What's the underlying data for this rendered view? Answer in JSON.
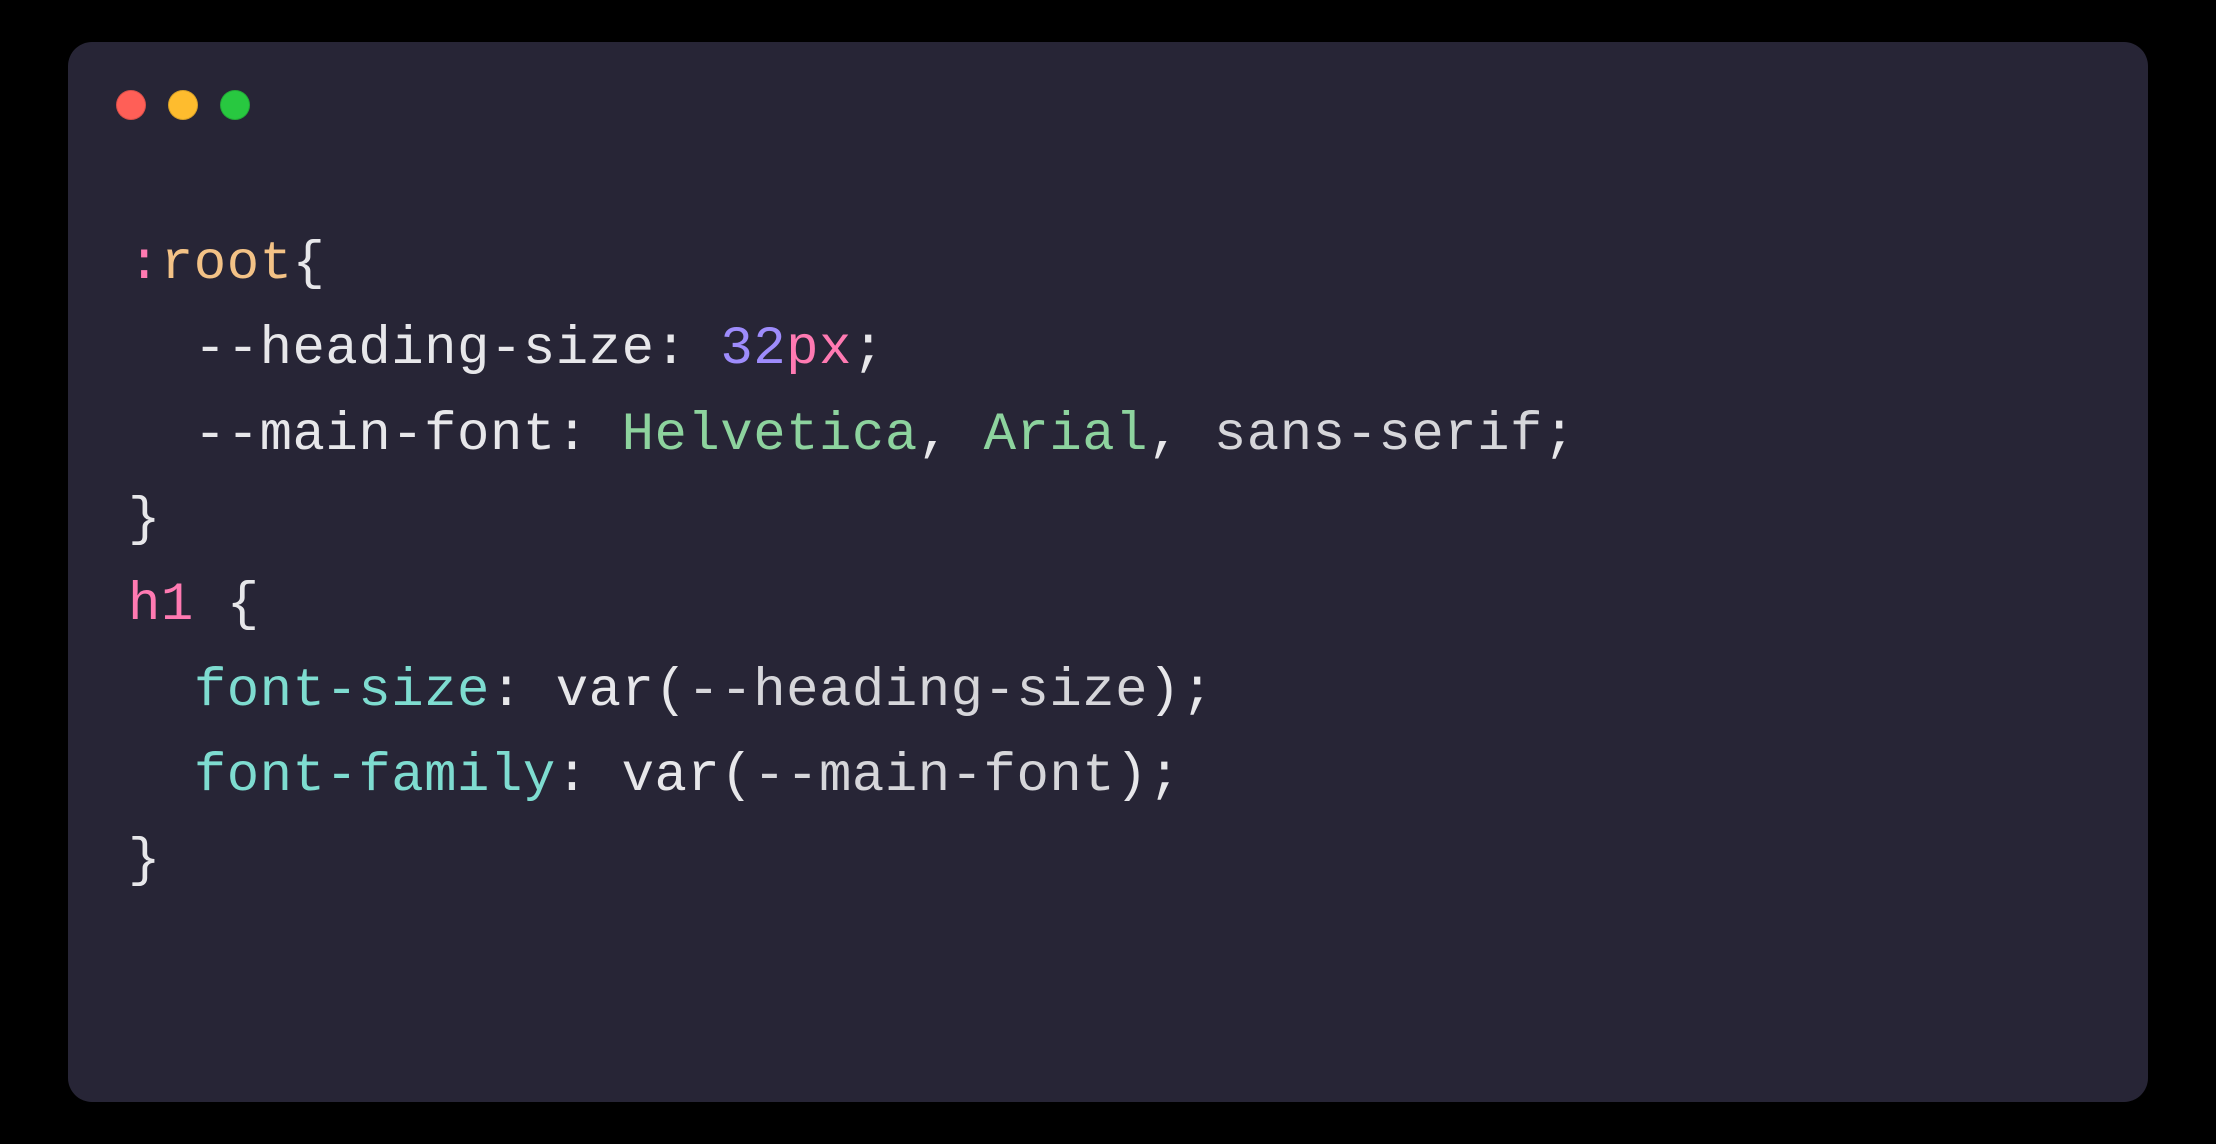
{
  "window": {
    "traffic_lights": [
      "close",
      "minimize",
      "zoom"
    ]
  },
  "colors": {
    "bg": "#000000",
    "panel": "#272536",
    "text": "#e7e7ea",
    "pink": "#ff7ab2",
    "peach": "#f3c286",
    "purple": "#9e8cfc",
    "green": "#8dd39e",
    "teal": "#7edcd0",
    "tl_red": "#ff5f57",
    "tl_yellow": "#febc2e",
    "tl_green": "#28c840"
  },
  "code": {
    "language": "css",
    "indent": "  ",
    "lines": {
      "l1": {
        "colon": ":",
        "selector": "root",
        "brace": "{"
      },
      "l2": {
        "prop": "--heading-size",
        "colon": ":",
        "sp": " ",
        "num": "32",
        "unit": "px",
        "semi": ";"
      },
      "l3": {
        "prop": "--main-font",
        "colon": ":",
        "sp": " ",
        "v1": "Helvetica",
        "c1": ",",
        "sp2": " ",
        "v2": "Arial",
        "c2": ",",
        "sp3": " ",
        "v3": "sans-serif",
        "semi": ";"
      },
      "l4": {
        "brace": "}"
      },
      "l5": {
        "selector": "h1",
        "sp": " ",
        "brace": "{"
      },
      "l6": {
        "prop": "font-size",
        "colon": ":",
        "sp": " ",
        "func": "var",
        "open": "(",
        "arg": "--heading-size",
        "close": ")",
        "semi": ";"
      },
      "l7": {
        "prop": "font-family",
        "colon": ":",
        "sp": " ",
        "func": "var",
        "open": "(",
        "arg": "--main-font",
        "close": ")",
        "semi": ";"
      },
      "l8": {
        "brace": "}"
      }
    }
  }
}
